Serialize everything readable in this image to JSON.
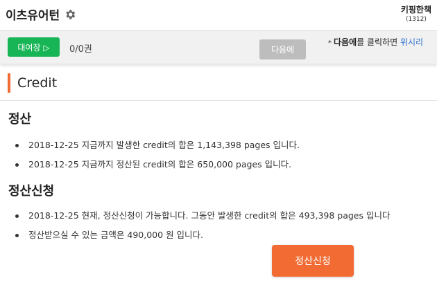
{
  "header": {
    "site_title": "이츠유어턴",
    "keeping_label": "키핑한책",
    "keeping_count": "(1312)"
  },
  "toolbar": {
    "lend_label": "대여장 ▷",
    "count": "0/0권",
    "next_label": "다음에",
    "hint_star": "*",
    "hint_strong": "다음에",
    "hint_text": "를 클릭하면",
    "hint_link": "위시리"
  },
  "section": {
    "title": "Credit"
  },
  "settlement": {
    "heading": "정산",
    "items": [
      "2018-12-25 지금까지 발생한 credit의 합은 1,143,398 pages 입니다.",
      "2018-12-25 지금까지 정산된 credit의 합은 650,000 pages 입니다."
    ]
  },
  "application": {
    "heading": "정산신청",
    "items": [
      "2018-12-25 현재, 정산신청이 가능합니다. 그동안 발생한 credit의 합은 493,398 pages 입니다",
      "정산받으실 수 있는 금액은 490,000 원 입니다."
    ],
    "button_label": "정산신청"
  },
  "colors": {
    "accent_orange": "#f26b33",
    "green": "#17b556",
    "disabled_gray": "#bdbdbd",
    "link_blue": "#2a6fcf"
  },
  "icons": {
    "settings": "gear-icon"
  }
}
